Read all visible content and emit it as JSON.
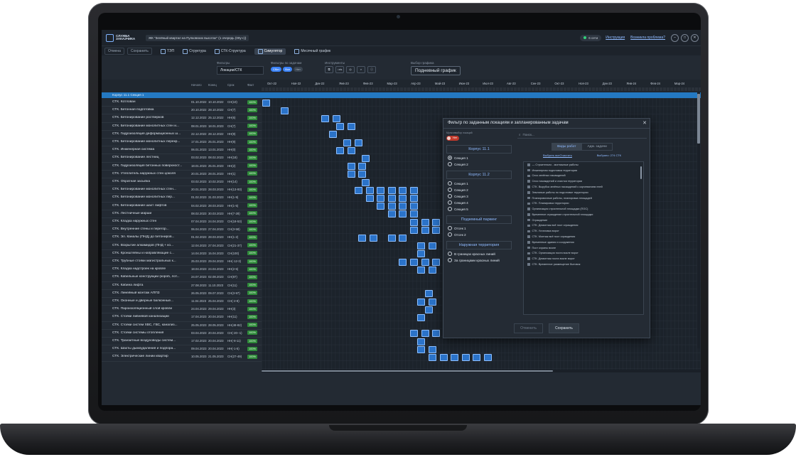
{
  "app": {
    "logo_text": "СЛУЖБА ЗАКАЗЧИКА",
    "project": "ЖК \"Зелёный квартал на Пулковских высотах\" (1 очередь (00у-с))",
    "status": "6 сети",
    "link_instructions": "Инструкция",
    "link_problem": "Возникла проблема?",
    "min": "–",
    "max": "□",
    "close": "✕"
  },
  "toolbar": {
    "cancel": "Отмена",
    "save": "Сохранить",
    "tabs": [
      "ТЭП",
      "Структура",
      "СТК-Структура",
      "Симулятор",
      "Месячный график"
    ]
  },
  "filters": {
    "label": "Фильтры",
    "value": "Локации/СТК",
    "tasks_label": "Фильтры по задачам",
    "chips": [
      "Сбит",
      "Все",
      "Нет"
    ],
    "tools_label": "Инструменты",
    "tools": [
      "⧉",
      "↓xls",
      "◎",
      "⌕",
      "ⓘ"
    ],
    "schedule_label": "Выбор графика",
    "schedule_value": "Подневный график"
  },
  "columns": {
    "start": "Начало",
    "end": "Конец",
    "duration": "Срок",
    "fact": "Факт"
  },
  "months": [
    "Окт-22",
    "Ноя-22",
    "Дек-22",
    "Янв-23",
    "Фев-23",
    "Мар-23",
    "Апр-23",
    "Май-23",
    "Июн-23",
    "Июл-23",
    "Авг-23",
    "Сен-23",
    "Окт-23",
    "Ноя-23",
    "Дек-23",
    "Янв-24",
    "Фев-24",
    "Мар-24"
  ],
  "section": "Корпус 11.1 Секция 1",
  "rows": [
    {
      "name": "СТК. Котлован",
      "start": "01.10.2022",
      "end": "10.10.2022",
      "dur": "СН(10)",
      "fact": "100%"
    },
    {
      "name": "СТК. Бетонная подготовка",
      "start": "20.10.2022",
      "end": "28.10.2022",
      "dur": "СН(7)",
      "fact": "100%"
    },
    {
      "name": "СТК. Бетонирование ростверков",
      "start": "12.12.2022",
      "end": "25.12.2022",
      "dur": "НН(6)",
      "fact": "100%"
    },
    {
      "name": "СТК. Бетонирование монолитных стен и...",
      "start": "08.01.2023",
      "end": "18.01.2023",
      "dur": "СН(7)",
      "fact": "100%"
    },
    {
      "name": "СТК. Гидроизоляция деформационных ш...",
      "start": "22.12.2022",
      "end": "28.12.2022",
      "dur": "НН(9)",
      "fact": "100%"
    },
    {
      "name": "СТК. Бетонирование монолитных перекр...",
      "start": "17.01.2023",
      "end": "25.01.2023",
      "dur": "НН(9)",
      "fact": "100%"
    },
    {
      "name": "СТК. Инженерная система",
      "start": "06.01.2023",
      "end": "13.01.2023",
      "dur": "НН(0)",
      "fact": "100%"
    },
    {
      "name": "СТК. Бетонирование лестниц",
      "start": "03.02.2023",
      "end": "08.02.2023",
      "dur": "НН(18)",
      "fact": "100%"
    },
    {
      "name": "СТК. Гидроизоляция бетонных поверхност...",
      "start": "18.01.2023",
      "end": "25.01.2023",
      "dur": "НН(2)",
      "fact": "100%"
    },
    {
      "name": "СТК. Утеплитель наружных стен цоколя",
      "start": "20.01.2023",
      "end": "28.01.2023",
      "dur": "НН(1)",
      "fact": "100%"
    },
    {
      "name": "СТК. Обратная засыпка",
      "start": "03.02.2023",
      "end": "10.02.2023",
      "dur": "НН(14)",
      "fact": "100%"
    },
    {
      "name": "СТК. Бетонирование монолитных стен...",
      "start": "20.01.2023",
      "end": "28.03.2023",
      "dur": "НН(13-93)",
      "fact": "100%"
    },
    {
      "name": "СТК. Бетонирование монолитных пер...",
      "start": "01.02.2023",
      "end": "31.03.2023",
      "dur": "НН(1-9)",
      "fact": "100%"
    },
    {
      "name": "СТК. Бетонирование шахт лифтов",
      "start": "04.02.2023",
      "end": "28.03.2023",
      "dur": "НН(1-5)",
      "fact": "100%"
    },
    {
      "name": "СТК. Лестничные марши",
      "start": "08.02.2023",
      "end": "30.03.2023",
      "dur": "НН(7-28)",
      "fact": "100%"
    },
    {
      "name": "СТК. Кладка наружных стен",
      "start": "07.04.2023",
      "end": "24.04.2023",
      "dur": "СН(18-53)",
      "fact": "100%"
    },
    {
      "name": "СТК. Внутренние стены и перегор...",
      "start": "06.04.2023",
      "end": "27.04.2023",
      "dur": "СН(3-58)",
      "fact": "100%"
    },
    {
      "name": "СТК. Эл. Каналы (ПНД) до бетониров...",
      "start": "01.02.2023",
      "end": "28.03.2023",
      "dur": "НН(1-2)",
      "fact": "100%"
    },
    {
      "name": "СТК. Вскрытие алкамидов (ПНД + ко...",
      "start": "12.04.2023",
      "end": "27.04.2023",
      "dur": "СН(21-37)",
      "fact": "100%"
    },
    {
      "name": "СТК. Кронштейны и направляющие с...",
      "start": "14.04.2023",
      "end": "15.04.2023",
      "dur": "СН(100)",
      "fact": "100%"
    },
    {
      "name": "СТК. Трубные стояки магистральных к...",
      "start": "25.03.2023",
      "end": "29.04.2023",
      "dur": "НН(-12-3)",
      "fact": "100%"
    },
    {
      "name": "СТК. Кладка надстроек на кровле",
      "start": "18.04.2023",
      "end": "24.04.2023",
      "dur": "НН(2-5)",
      "fact": "100%"
    },
    {
      "name": "СТК. Кабельные конструкции (короб, лот...",
      "start": "24.07.2023",
      "end": "02.08.2023",
      "dur": "СН(87)",
      "fact": "100%"
    },
    {
      "name": "СТК. Кабина лифта",
      "start": "27.08.2023",
      "end": "11.10.2023",
      "dur": "СН(11)",
      "fact": "100%"
    },
    {
      "name": "СТК. Линейный монтаж АППЗ",
      "start": "26.05.2023",
      "end": "09.07.2023",
      "dur": "СН(3-97)",
      "fact": "100%"
    },
    {
      "name": "СТК. Оконные и дверные балконные...",
      "start": "11.04.2023",
      "end": "25.04.2023",
      "dur": "СН(-2-8)",
      "fact": "100%"
    },
    {
      "name": "СТК. Пароизоляционный слой кровли",
      "start": "24.04.2023",
      "end": "29.04.2023",
      "dur": "НН(3)",
      "fact": "100%"
    },
    {
      "name": "СТК. Стояки ливневой канализации",
      "start": "17.04.2023",
      "end": "20.04.2023",
      "dur": "НН(11)",
      "fact": "100%"
    },
    {
      "name": "СТК. Стояки систем ХВС, ГВС, канализ...",
      "start": "25.05.2023",
      "end": "28.05.2023",
      "dur": "НН(48-82)",
      "fact": "100%"
    },
    {
      "name": "СТК. Стояки системы отопления",
      "start": "03.04.2023",
      "end": "20.04.2023",
      "dur": "СН(-20--1)",
      "fact": "100%"
    },
    {
      "name": "СТК. Транзитные воздуховоды систем...",
      "start": "17.02.2023",
      "end": "20.04.2023",
      "dur": "НН(-8-11)",
      "fact": "100%"
    },
    {
      "name": "СТК. Шахты дымоудаления и подпора...",
      "start": "09.04.2023",
      "end": "20.04.2023",
      "dur": "НН(-1-5)",
      "fact": "100%"
    },
    {
      "name": "СТК. Электрические линии квартир",
      "start": "10.05.2023",
      "end": "21.05.2023",
      "dur": "СН(27-49)",
      "fact": "100%"
    }
  ],
  "modal": {
    "title": "Фильтр по заданным локациям и запланированным задачам",
    "close": "✕",
    "toggle_label": "Мультивыбор локаций",
    "toggle_value": "Нет",
    "groups": [
      {
        "title": "Корпус 11.1",
        "items": [
          "Секция 1",
          "Секция 2"
        ]
      },
      {
        "title": "Корпус 11.2",
        "items": [
          "Секция 1",
          "Секция 2",
          "Секция 3",
          "Секция 4",
          "Секция 5"
        ]
      },
      {
        "title": "Подземный паркинг",
        "items": [
          "Отсек 1",
          "Отсек 2"
        ]
      },
      {
        "title": "Наружная территория",
        "items": [
          "В границах красных линий",
          "За границами красных линий"
        ]
      }
    ],
    "search_placeholder": "Поиск...",
    "seg": [
      "Виды работ",
      "Адм. задачи"
    ],
    "select_all": "Выбрать все",
    "clear": "Очистить",
    "selected": "Выбрано: 274 СТК",
    "list": [
      "— Строительно - монтажные работы",
      "Инженерная подготовка территории",
      "Снос зелёных насаждений",
      "Снос насаждений и очистка территории",
      "СТК. Вырубка зелёных насаждений с корчеванием пней",
      "Земляные работы по подготовке территории",
      "Планировочные работы, планировка площадей",
      "СТК. Планировка территории",
      "Организация строительной площадки (ПОС)",
      "Временное ограждение строительной площадки",
      "Ограждение",
      "СТК. Демонтаж всё пост ограждения",
      "СТК. Установка ворот",
      "СТК. Монтаж всё пост ограждения",
      "Временные здания и сооружения",
      "Пост охраны возле",
      "СТК. Организация поста возле ворот",
      "СТК. Демонтаж поста возле ворот",
      "СТК. Временное размещение бытовок"
    ],
    "cancel": "Отменить",
    "save": "Сохранить"
  }
}
